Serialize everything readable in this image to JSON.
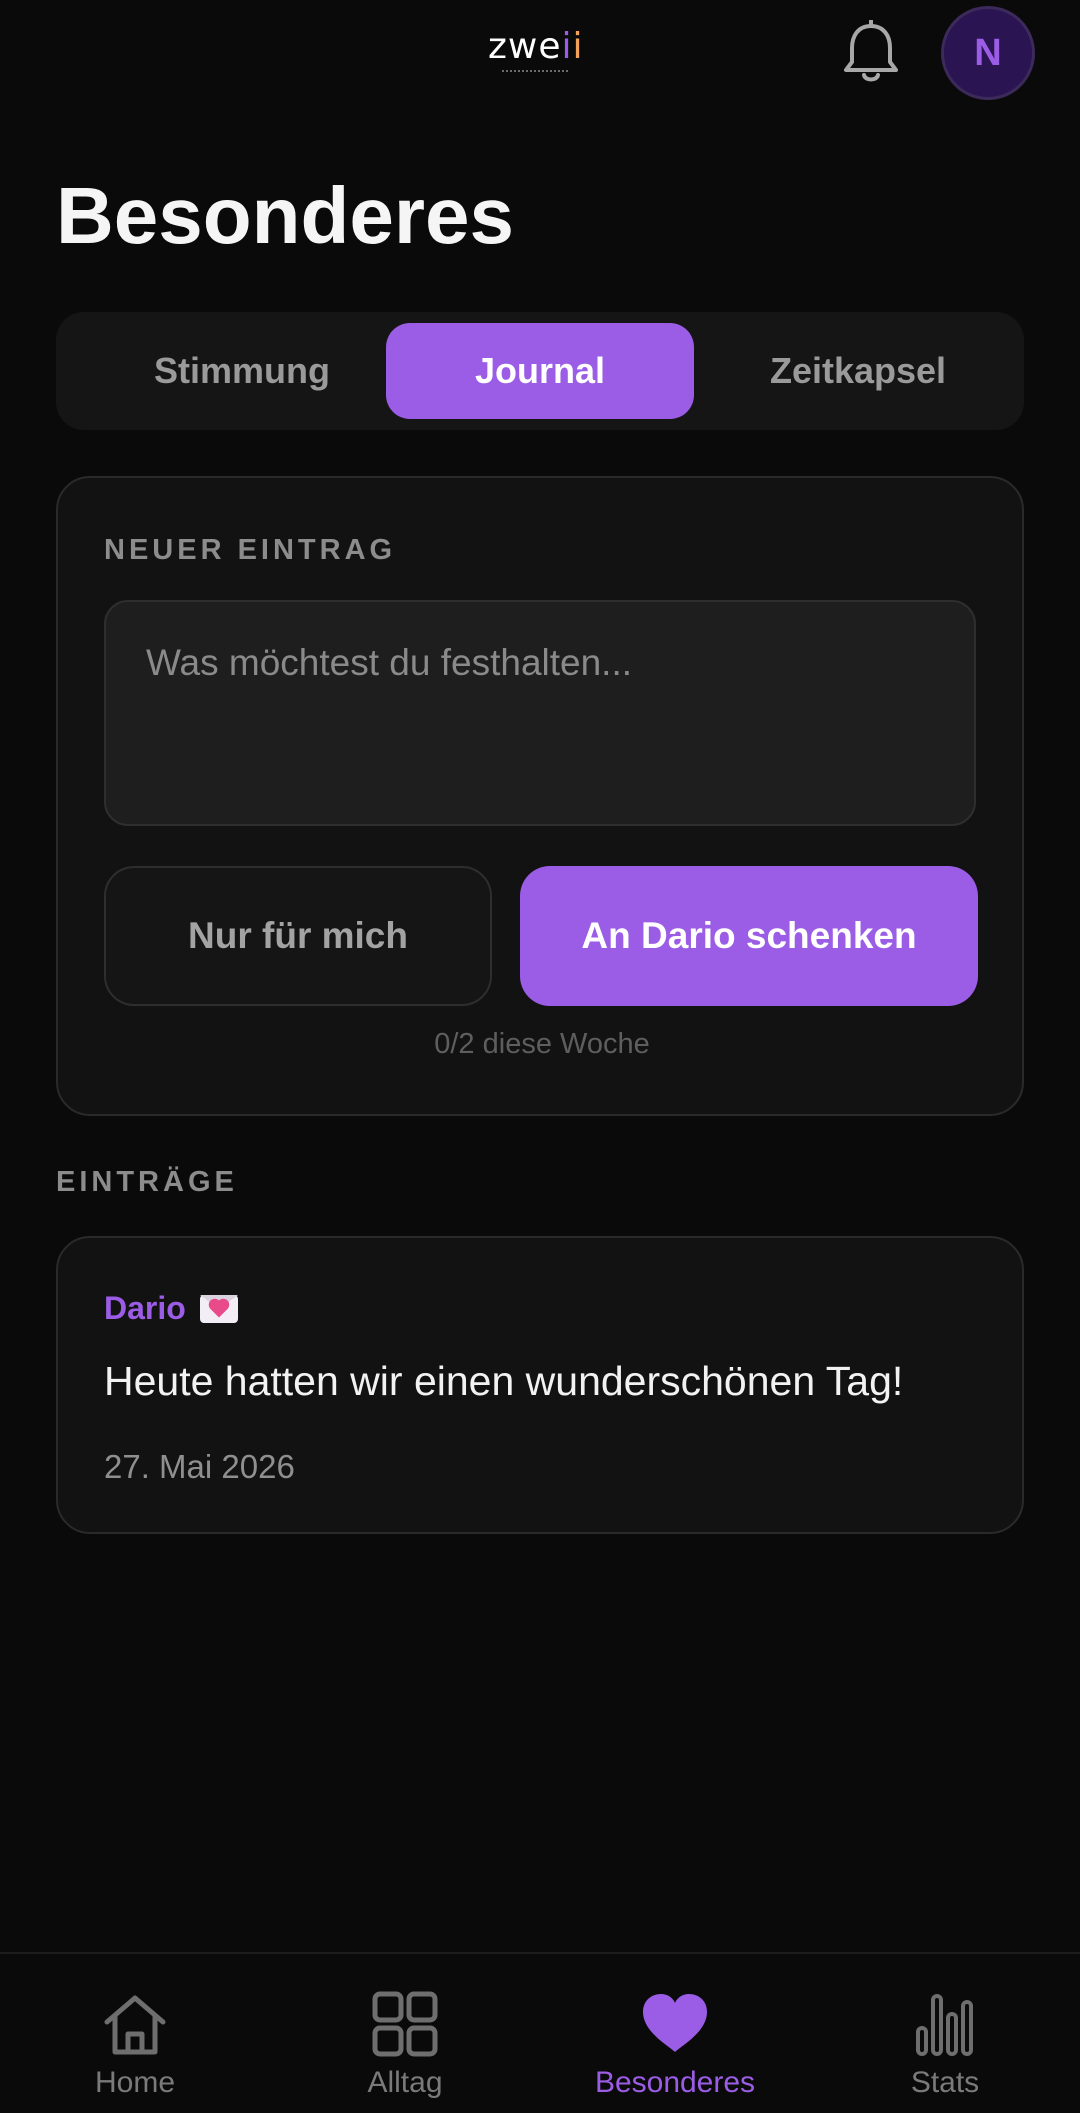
{
  "header": {
    "logo_main": "zwe",
    "logo_i1": "i",
    "logo_i2": "i",
    "avatar_initial": "N",
    "icons": {
      "notifications": "bell-icon"
    }
  },
  "page_title": "Besonderes",
  "tabs": [
    {
      "label": "Stimmung",
      "active": false
    },
    {
      "label": "Journal",
      "active": true
    },
    {
      "label": "Zeitkapsel",
      "active": false
    }
  ],
  "new_entry": {
    "section_label": "NEUER EINTRAG",
    "placeholder": "Was möchtest du festhalten...",
    "value": "",
    "private_button": "Nur für mich",
    "gift_button": "An Dario schenken",
    "counter": "0/2 diese Woche"
  },
  "entries_label": "EINTRÄGE",
  "entries": [
    {
      "author": "Dario",
      "icon": "love-letter-icon",
      "text": "Heute hatten wir einen wunderschönen Tag!",
      "date": "27. Mai 2026"
    }
  ],
  "bottom_nav": [
    {
      "label": "Home",
      "icon": "home-icon",
      "active": false
    },
    {
      "label": "Alltag",
      "icon": "grid-icon",
      "active": false
    },
    {
      "label": "Besonderes",
      "icon": "heart-icon",
      "active": true
    },
    {
      "label": "Stats",
      "icon": "bar-chart-icon",
      "active": false
    }
  ],
  "colors": {
    "accent": "#9b5de5",
    "background": "#0a0a0a",
    "card": "#121212",
    "logo_second_i": "#f4a259"
  }
}
